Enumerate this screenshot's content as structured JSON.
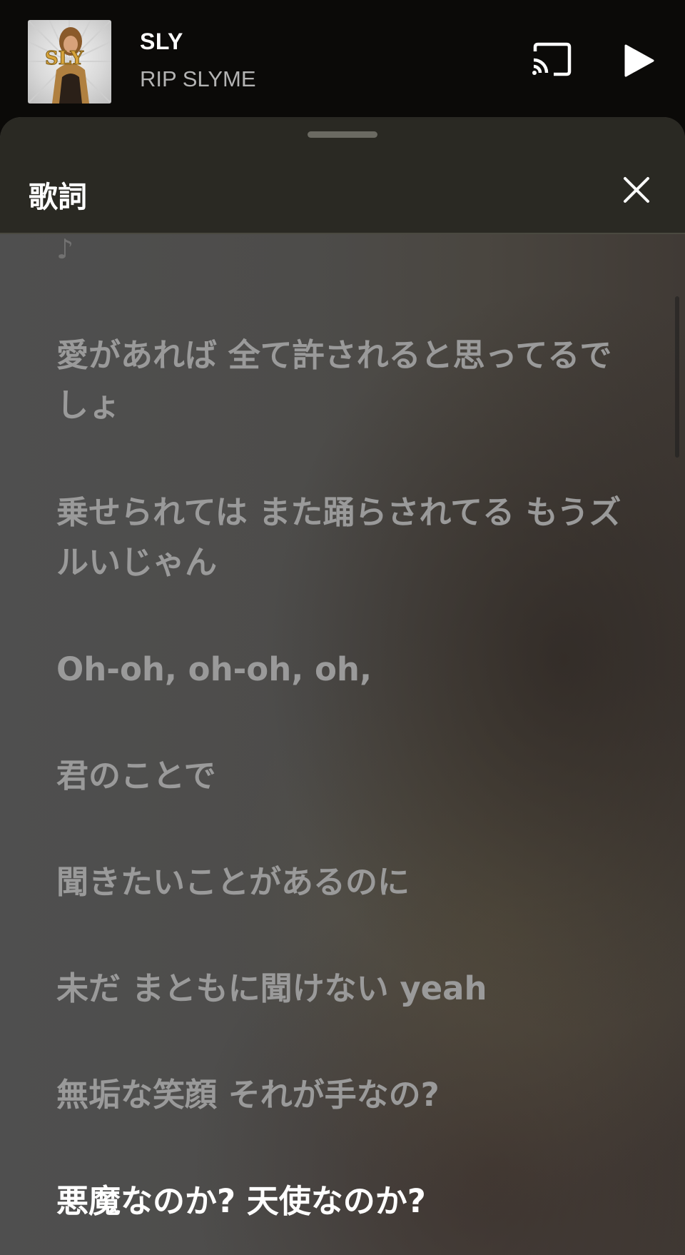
{
  "now_playing": {
    "title": "SLY",
    "artist": "RIP SLYME"
  },
  "icons": {
    "cast": "cast-icon",
    "play": "play-icon",
    "close": "close-icon",
    "note": "music-note-icon"
  },
  "lyrics_panel": {
    "title": "歌詞",
    "note_glyph": "♪",
    "lines": [
      "愛があれば 全て許されると思ってるでしょ",
      "乗せられては また踊らされてる もうズルいじゃん",
      "Oh-oh, oh-oh, oh,",
      "君のことで",
      "聞きたいことがあるのに",
      "未だ まともに聞けない yeah",
      "無垢な笑顔 それが手なの?",
      "悪魔なのか? 天使なのか?"
    ],
    "active_line_index": 7
  },
  "colors": {
    "header_bg": "#2a2923",
    "active_lyric": "#ffffff",
    "inactive_lyric": "#9a9a9a"
  }
}
